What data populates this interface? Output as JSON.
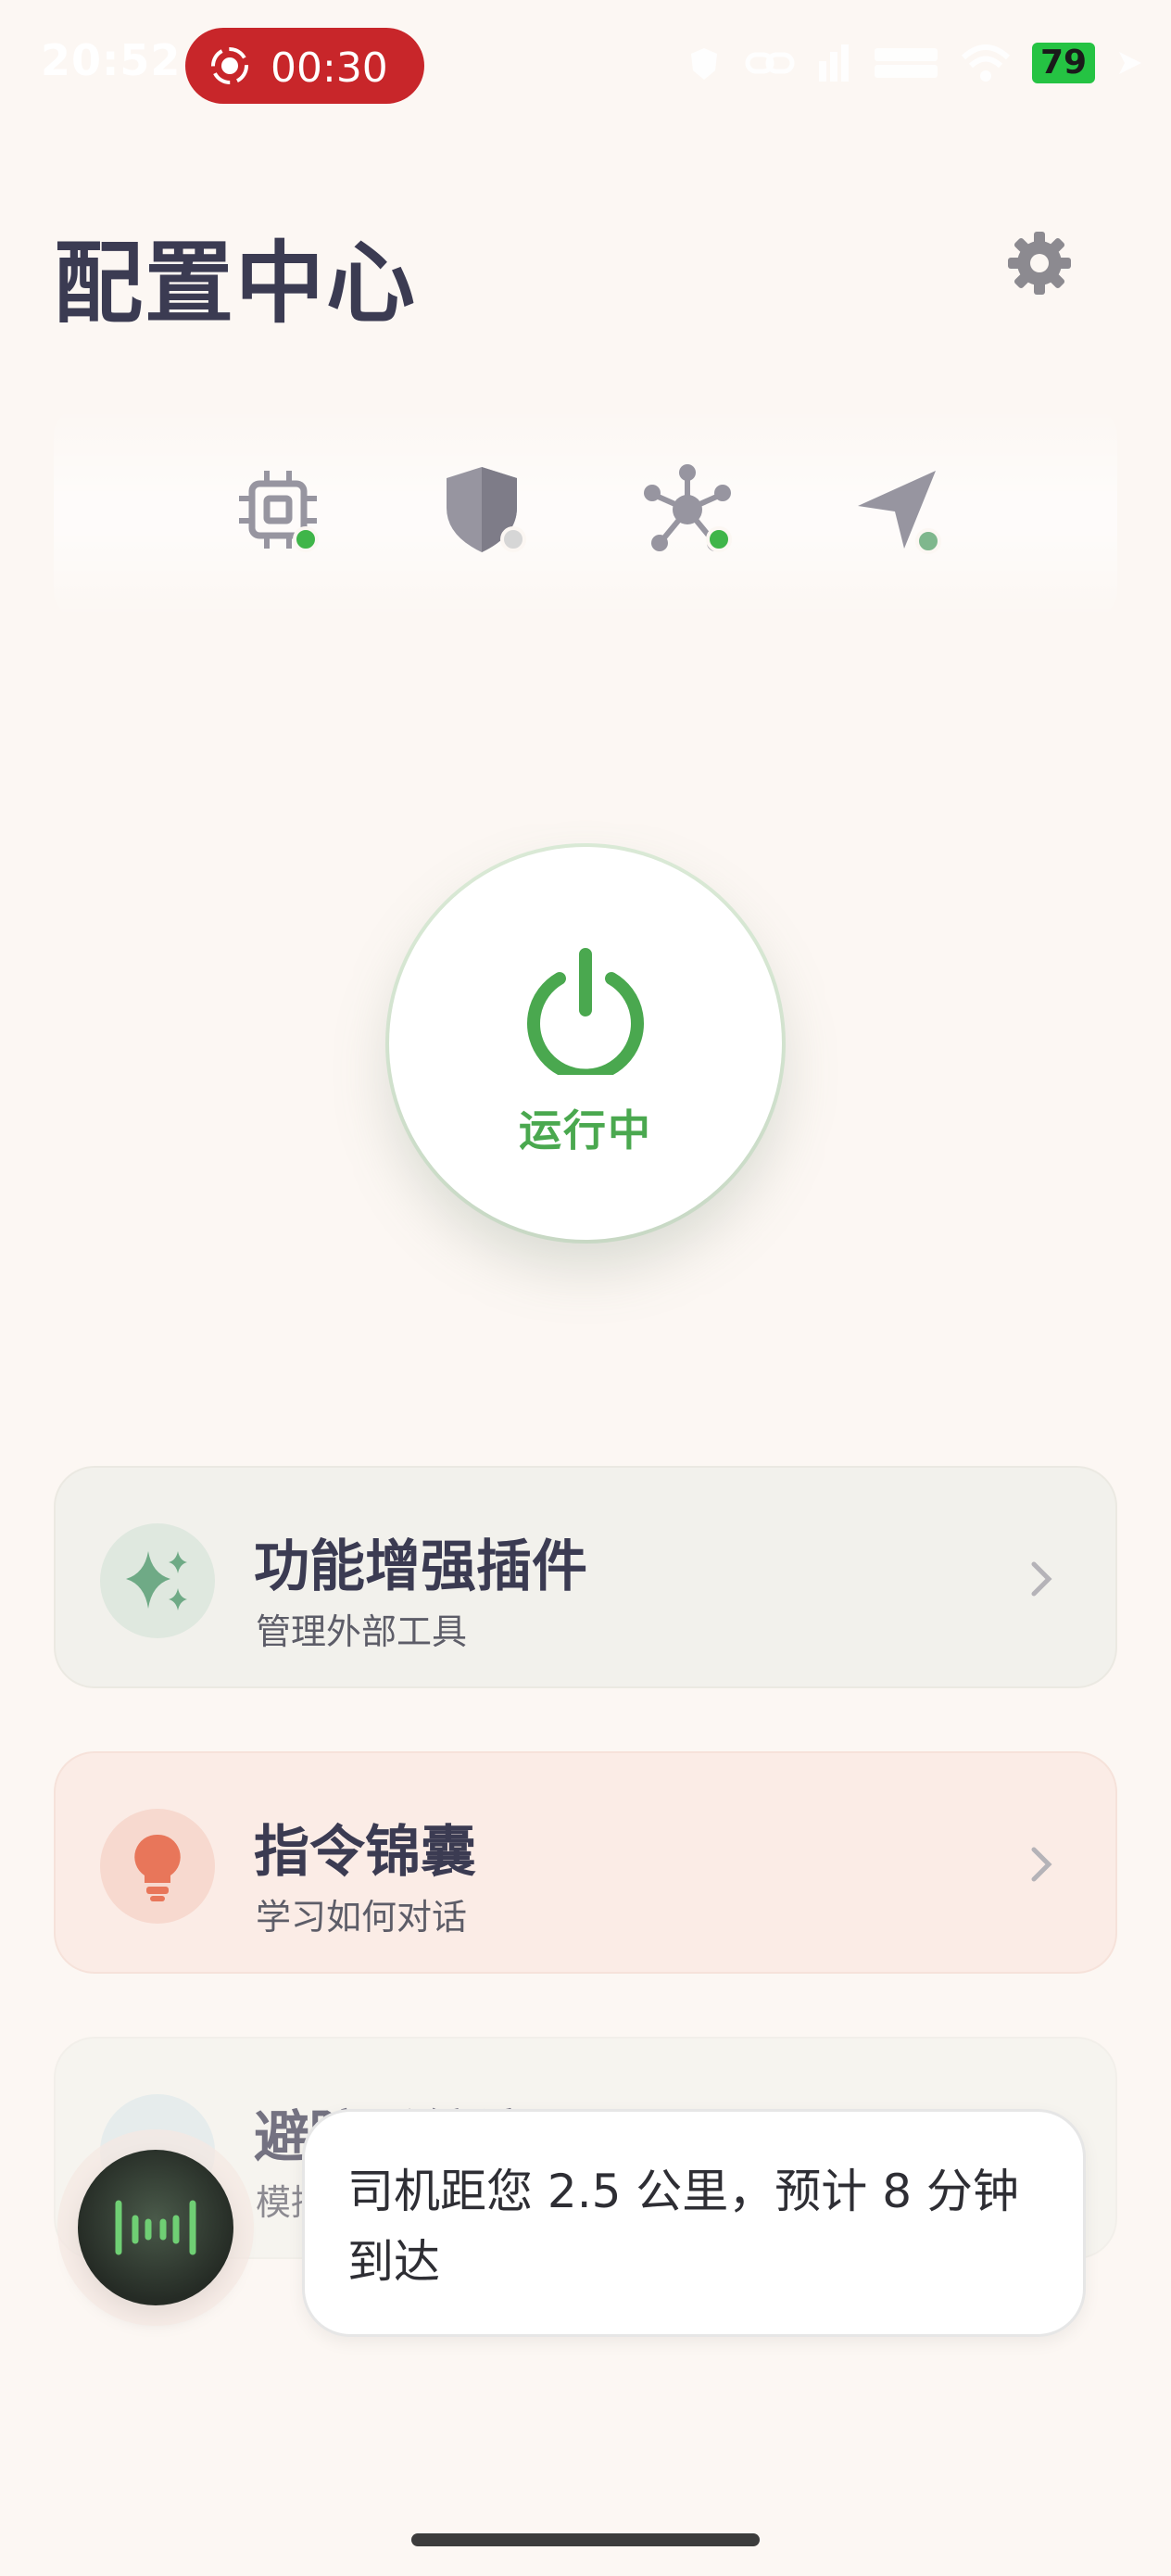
{
  "status_bar": {
    "time": "20:52",
    "recording_time": "00:30",
    "battery": "79",
    "icons": [
      "alarm-icon",
      "link-icon",
      "signal-icon",
      "network-speed-icon",
      "wifi-icon",
      "battery-icon",
      "location-icon"
    ]
  },
  "header": {
    "title": "配置中心",
    "settings_icon": "gear-icon"
  },
  "status_indicators": [
    {
      "icon": "chip-icon",
      "dot_color": "#3fb549"
    },
    {
      "icon": "shield-icon",
      "dot_color": "#d6d6d6"
    },
    {
      "icon": "network-hub-icon",
      "dot_color": "#3fb549"
    },
    {
      "icon": "navigation-icon",
      "dot_color": "#7fb78d"
    }
  ],
  "power": {
    "label": "运行中",
    "color": "#4aa84f"
  },
  "cards": [
    {
      "title": "功能增强插件",
      "subtitle": "管理外部工具",
      "icon": "sparkles-icon"
    },
    {
      "title": "指令锦囊",
      "subtitle": "学习如何对话",
      "icon": "lightbulb-icon"
    },
    {
      "title": "避障系统演示",
      "subtitle": "模拟操",
      "icon": "demo-icon"
    }
  ],
  "toast": {
    "text": "司机距您 2.5 公里，预计 8 分钟到达"
  },
  "colors": {
    "background": "#fcf7f3",
    "accent_green": "#4aa84f",
    "record_red": "#c8262a",
    "title": "#3b3b52"
  }
}
